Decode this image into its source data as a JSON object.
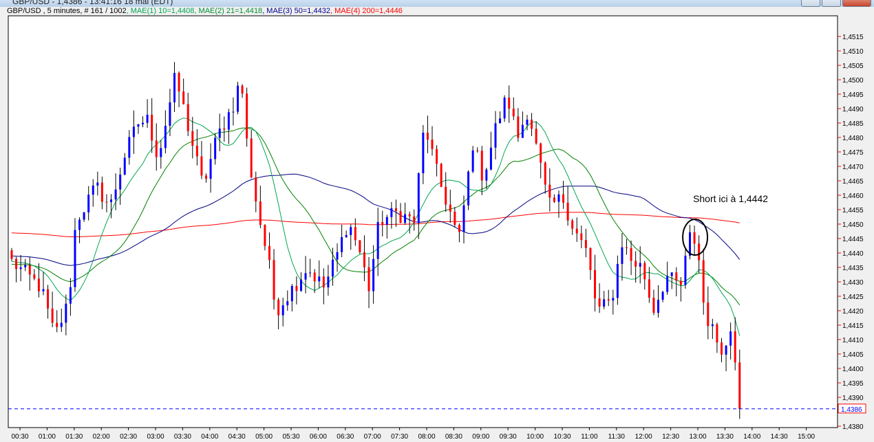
{
  "window": {
    "title": "GBP/USD - 1,4386 - 13:41:16  18 mai (EDT)"
  },
  "legend": {
    "symbol": "GBP/USD , 5 minutes, # 161 / 1002",
    "ma1": ", MAE(1) 10=1,4408",
    "ma2": ", MAE(2) 21=1,4418",
    "ma3": ", MAE(3) 50=1,4432",
    "ma4": ", MAE(4) 200=1,4446"
  },
  "colors": {
    "up": "#0000ff",
    "down": "#ff0000",
    "ma10": "#00a651",
    "ma21": "#008000",
    "ma50": "#000080",
    "ma200": "#ff0000",
    "last": "#0000ff"
  },
  "chart_data": {
    "type": "candlestick",
    "title": "GBP/USD , 5 minutes",
    "ylim": [
      1.4378,
      1.4522
    ],
    "y_ticks": [
      "1,4515",
      "1,4510",
      "1,4505",
      "1,4500",
      "1,4495",
      "1,4490",
      "1,4485",
      "1,4480",
      "1,4475",
      "1,4470",
      "1,4465",
      "1,4460",
      "1,4455",
      "1,4450",
      "1,4445",
      "1,4440",
      "1,4435",
      "1,4430",
      "1,4425",
      "1,4420",
      "1,4415",
      "1,4410",
      "1,4405",
      "1,4400",
      "1,4395",
      "1,4390",
      "1,4380"
    ],
    "y_tick_values": [
      1.4515,
      1.451,
      1.4505,
      1.45,
      1.4495,
      1.449,
      1.4485,
      1.448,
      1.4475,
      1.447,
      1.4465,
      1.446,
      1.4455,
      1.445,
      1.4445,
      1.444,
      1.4435,
      1.443,
      1.4425,
      1.442,
      1.4415,
      1.441,
      1.4405,
      1.44,
      1.4395,
      1.439,
      1.438
    ],
    "x_ticks": [
      "00:30",
      "01:00",
      "01:30",
      "02:00",
      "02:30",
      "03:00",
      "03:30",
      "04:00",
      "04:30",
      "05:00",
      "05:30",
      "06:00",
      "06:30",
      "07:00",
      "07:30",
      "08:00",
      "08:30",
      "09:00",
      "09:30",
      "10:00",
      "10:30",
      "11:00",
      "11:30",
      "12:00",
      "12:30",
      "13:00",
      "13:30",
      "14:00",
      "14:30",
      "15:00"
    ],
    "bars_per_tick": 6,
    "close_keyframes": [
      [
        0,
        1.4437
      ],
      [
        6.5,
        1.4428
      ],
      [
        9.5,
        1.4411
      ],
      [
        12.6,
        1.4423
      ],
      [
        14.2,
        1.4451
      ],
      [
        18.7,
        1.4463
      ],
      [
        21.8,
        1.4456
      ],
      [
        24.8,
        1.4473
      ],
      [
        27.9,
        1.4485
      ],
      [
        30.1,
        1.4486
      ],
      [
        32.4,
        1.4473
      ],
      [
        36.2,
        1.4501
      ],
      [
        38.5,
        1.4487
      ],
      [
        42.3,
        1.4463
      ],
      [
        45.4,
        1.448
      ],
      [
        49.2,
        1.4492
      ],
      [
        50.7,
        1.4501
      ],
      [
        52.2,
        1.4475
      ],
      [
        54.5,
        1.4454
      ],
      [
        56.8,
        1.4437
      ],
      [
        58.4,
        1.442
      ],
      [
        62.2,
        1.4428
      ],
      [
        65.3,
        1.4435
      ],
      [
        69.1,
        1.4428
      ],
      [
        72.1,
        1.444
      ],
      [
        74.4,
        1.4451
      ],
      [
        76.7,
        1.4442
      ],
      [
        79.0,
        1.4428
      ],
      [
        81.3,
        1.4451
      ],
      [
        85.2,
        1.4454
      ],
      [
        89.0,
        1.4451
      ],
      [
        91.3,
        1.4485
      ],
      [
        94.3,
        1.4466
      ],
      [
        96.6,
        1.4456
      ],
      [
        98.9,
        1.4444
      ],
      [
        102.0,
        1.4478
      ],
      [
        104.3,
        1.4466
      ],
      [
        107.3,
        1.4485
      ],
      [
        109.6,
        1.4494
      ],
      [
        111.9,
        1.448
      ],
      [
        114.2,
        1.449
      ],
      [
        116.5,
        1.4473
      ],
      [
        118.8,
        1.4456
      ],
      [
        121.9,
        1.4459
      ],
      [
        124.2,
        1.4449
      ],
      [
        127.2,
        1.444
      ],
      [
        129.5,
        1.442
      ],
      [
        132.6,
        1.4423
      ],
      [
        134.9,
        1.4444
      ],
      [
        137.2,
        1.4437
      ],
      [
        139.5,
        1.4435
      ],
      [
        141.8,
        1.442
      ],
      [
        144.8,
        1.4432
      ],
      [
        147.9,
        1.4428
      ],
      [
        150.2,
        1.4447
      ],
      [
        151.7,
        1.4442
      ],
      [
        153.2,
        1.442
      ],
      [
        155.5,
        1.4411
      ],
      [
        157.8,
        1.4406
      ],
      [
        159.4,
        1.4416
      ],
      [
        160.6,
        1.4393
      ],
      [
        161,
        1.4386
      ]
    ],
    "ma_start": {
      "ma10": 1.4437,
      "ma21": 1.4436,
      "ma50": 1.4439,
      "ma200": 1.4447
    },
    "last_price": 1.4386,
    "last_price_label": "1,4386",
    "annotation": {
      "text": "Short ici à 1,4442",
      "bar": 151,
      "price": 1.4445
    }
  }
}
